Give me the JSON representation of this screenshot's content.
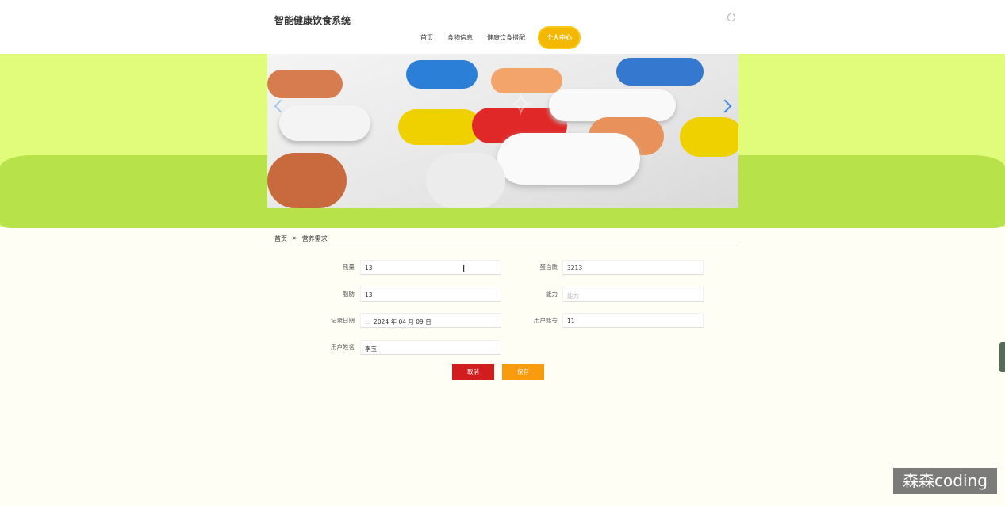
{
  "header": {
    "site_title": "智能健康饮食系统",
    "nav": [
      "首页",
      "食物信息",
      "健康饮食搭配",
      "个人中心"
    ],
    "active_nav": "个人中心"
  },
  "banner": {
    "image": "colorful-pills-photo"
  },
  "breadcrumb": {
    "home": "首页",
    "separator": ">",
    "current": "营养需求"
  },
  "form": {
    "calories_label": "热量",
    "calories_value": "13",
    "protein_label": "蛋白质",
    "protein_value": "3213",
    "fat_label": "脂肪",
    "fat_value": "13",
    "energy_label": "能力",
    "energy_placeholder": "能力",
    "record_date_label": "记录日期",
    "record_date_value": "2024 年 04 月 09 日",
    "user_account_label": "用户账号",
    "user_account_value": "11",
    "user_name_label": "用户姓名",
    "user_name_value": "李玉"
  },
  "buttons": {
    "cancel": "取消",
    "save": "保存"
  },
  "corner_watermark": "森森coding",
  "colors": {
    "accent": "#f5b800",
    "cancel": "#d11d1d",
    "save": "#f99b0e",
    "banner_green": "#b8e24a"
  }
}
